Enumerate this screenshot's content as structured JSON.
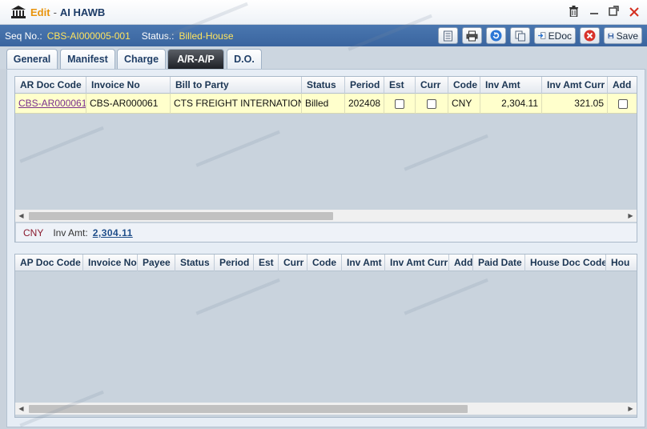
{
  "window": {
    "mode": "Edit",
    "separator": "-",
    "title": "AI HAWB"
  },
  "info": {
    "seq_label": "Seq No.:",
    "seq_value": "CBS-AI000005-001",
    "status_label": "Status.:",
    "status_value": "Billed-House"
  },
  "toolbar": {
    "edoc_label": "EDoc",
    "save_label": "Save"
  },
  "tabs": [
    {
      "label": "General"
    },
    {
      "label": "Manifest"
    },
    {
      "label": "Charge"
    },
    {
      "label": "A/R-A/P"
    },
    {
      "label": "D.O."
    }
  ],
  "ar_grid": {
    "columns": [
      "AR Doc Code",
      "Invoice No",
      "Bill to Party",
      "Status",
      "Period",
      "Est",
      "Curr",
      "Code",
      "Inv Amt",
      "Inv Amt Curr",
      "Add"
    ],
    "rows": [
      {
        "ar_doc_code": "CBS-AR000061",
        "invoice_no": "CBS-AR000061",
        "bill_to_party": "CTS FREIGHT INTERNATIONAL",
        "status": "Billed",
        "period": "202408",
        "est": false,
        "curr": false,
        "code": "CNY",
        "inv_amt": "2,304.11",
        "inv_amt_curr": "321.05",
        "add": false
      }
    ],
    "summary": {
      "currency": "CNY",
      "label": "Inv Amt:",
      "value": "2,304.11"
    }
  },
  "ap_grid": {
    "columns": [
      "AP Doc Code",
      "Invoice No",
      "Payee",
      "Status",
      "Period",
      "Est",
      "Curr",
      "Code",
      "Inv Amt",
      "Inv Amt Curr",
      "Add",
      "Paid Date",
      "House Doc Code",
      "Hou"
    ]
  },
  "colors": {
    "title_mode": "#e8930c",
    "info_bar": "#3f6aa4",
    "info_value": "#ffe45e",
    "active_tab": "#2a2d33",
    "selected_row": "#ffffcc"
  }
}
